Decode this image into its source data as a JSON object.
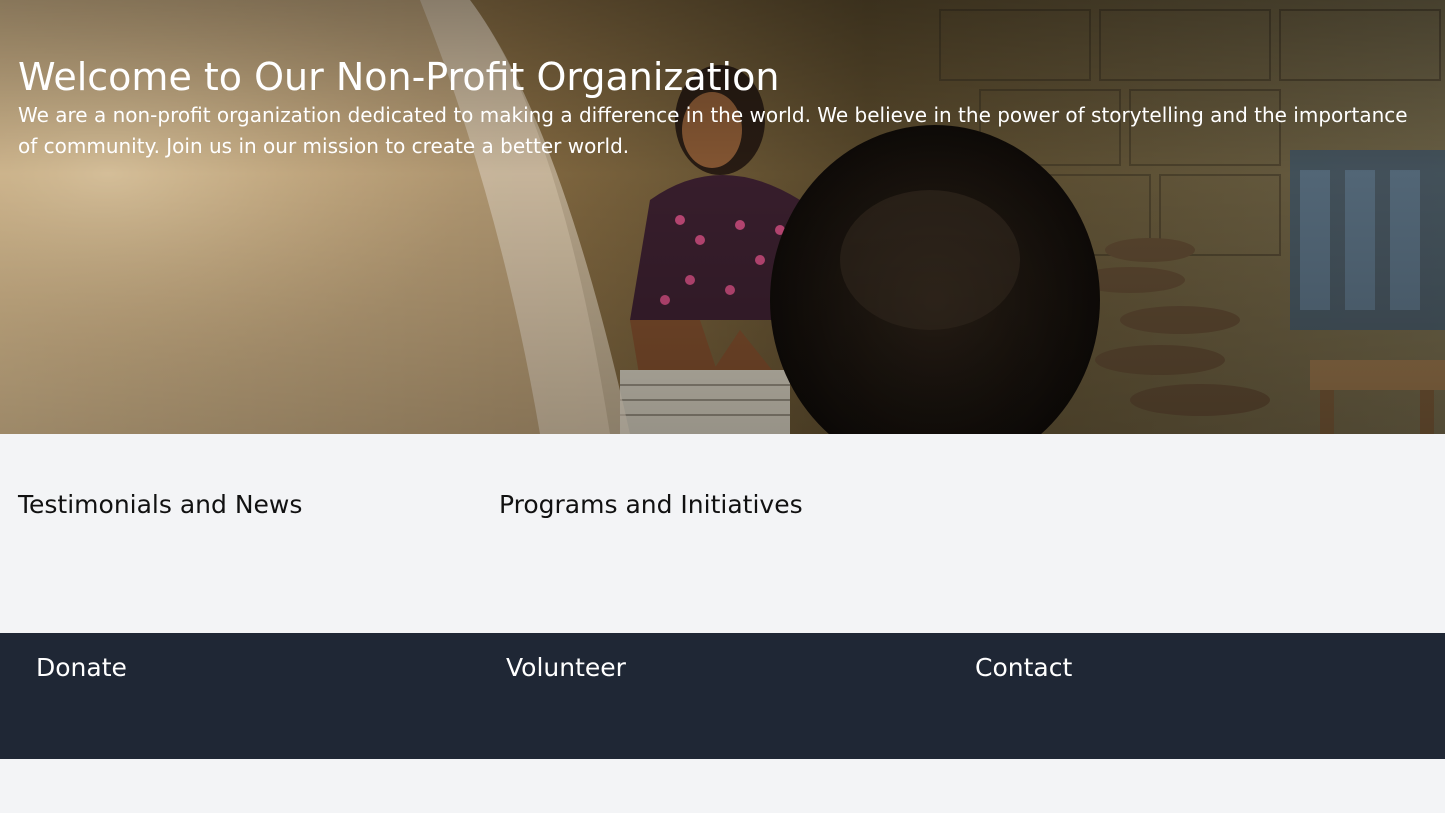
{
  "hero": {
    "title": "Welcome to Our Non-Profit Organization",
    "text": "We are a non-profit organization dedicated to making a difference in the world. We believe in the power of storytelling and the importance of community. Join us in our mission to create a better world."
  },
  "sections": {
    "testimonials_title": "Testimonials and News",
    "programs_title": "Programs and Initiatives"
  },
  "footer": {
    "donate_title": "Donate",
    "volunteer_title": "Volunteer",
    "contact_title": "Contact"
  },
  "colors": {
    "page_background": "#f3f4f6",
    "footer_background": "#1f2735",
    "hero_text": "#ffffff"
  }
}
